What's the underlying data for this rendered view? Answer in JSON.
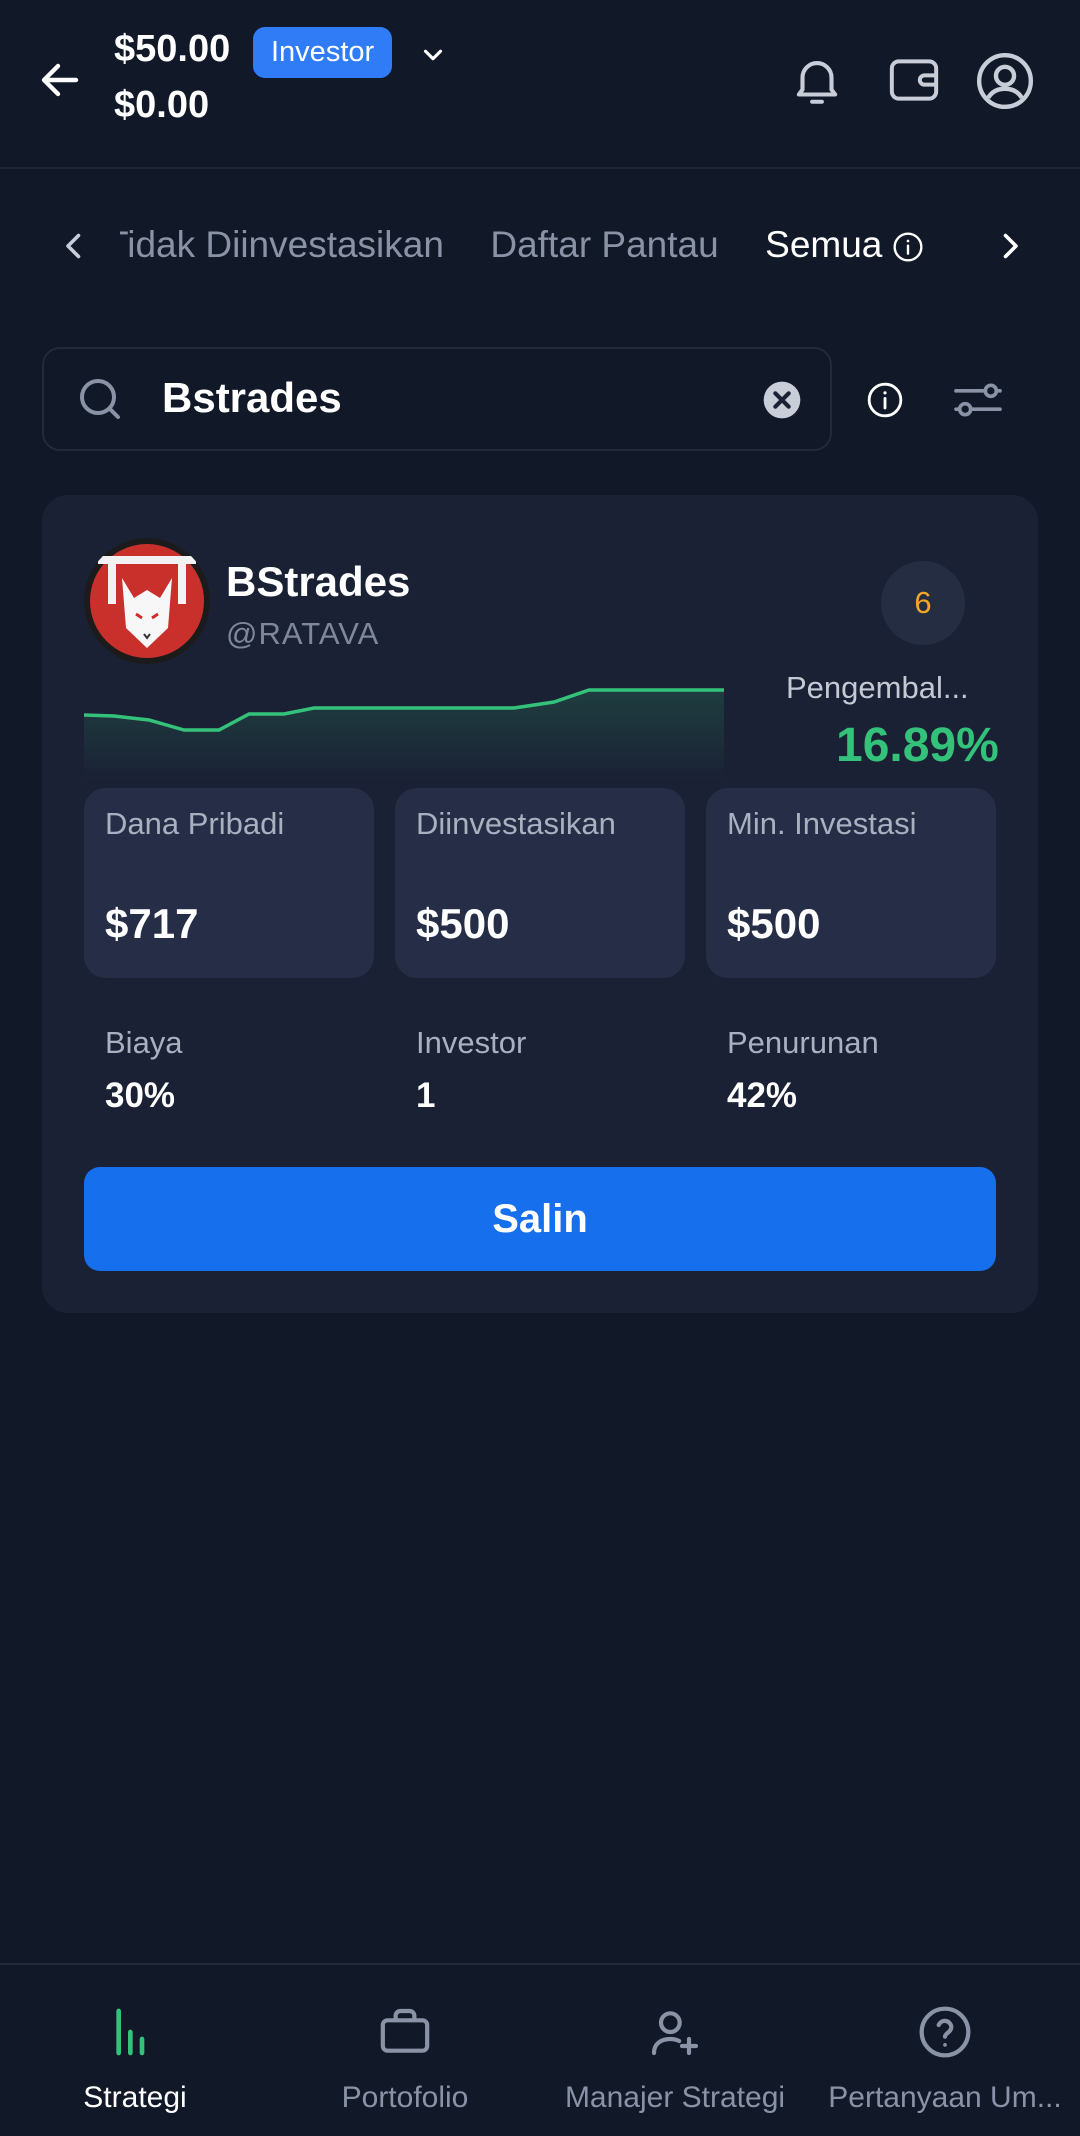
{
  "header": {
    "balance_primary": "$50.00",
    "balance_secondary": "$0.00",
    "role_badge": "Investor"
  },
  "tabs": {
    "items": [
      {
        "label": "Tidak Diinvestasikan",
        "active": false
      },
      {
        "label": "Daftar Pantau",
        "active": false
      },
      {
        "label": "Semua",
        "active": true
      }
    ]
  },
  "search": {
    "value": "Bstrades"
  },
  "card": {
    "name": "BStrades",
    "handle": "@RATAVA",
    "rank": "6",
    "return_label": "Pengembal...",
    "return_value": "16.89%",
    "stats": [
      {
        "label": "Dana Pribadi",
        "value": "$717"
      },
      {
        "label": "Diinvestasikan",
        "value": "$500"
      },
      {
        "label": "Min. Investasi",
        "value": "$500"
      }
    ],
    "details": [
      {
        "label": "Biaya",
        "value": "30%"
      },
      {
        "label": "Investor",
        "value": "1"
      },
      {
        "label": "Penurunan",
        "value": "42%"
      }
    ],
    "copy_button": "Salin",
    "accent_color": "#34c27a"
  },
  "bottom_nav": [
    {
      "label": "Strategi",
      "icon": "bar-chart-icon",
      "active": true
    },
    {
      "label": "Portofolio",
      "icon": "briefcase-icon",
      "active": false
    },
    {
      "label": "Manajer Strategi",
      "icon": "user-plus-icon",
      "active": false
    },
    {
      "label": "Pertanyaan Um...",
      "icon": "help-circle-icon",
      "active": false
    }
  ]
}
